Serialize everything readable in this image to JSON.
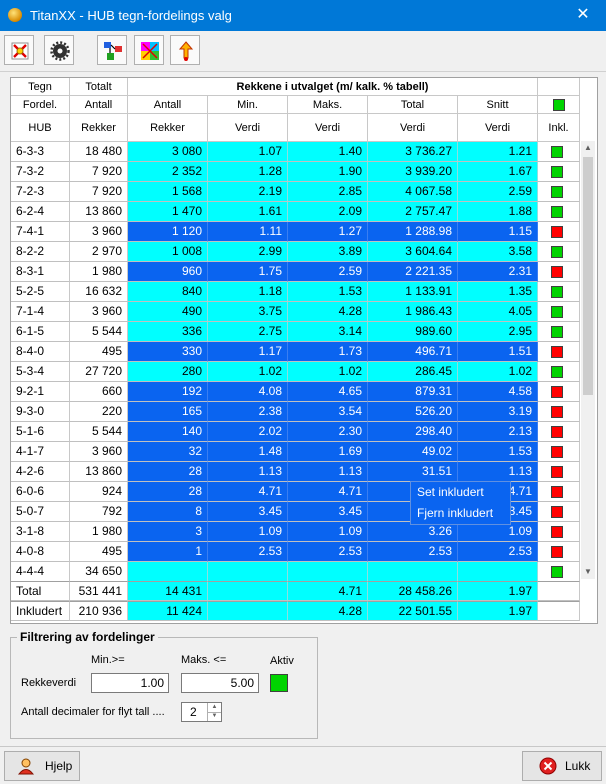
{
  "window": {
    "title": "TitanXX - HUB tegn-fordelings valg",
    "close_glyph": "✕"
  },
  "toolbar": {
    "buttons": [
      {
        "icon": "red-cross-star-icon"
      },
      {
        "icon": "gear-icon"
      },
      {
        "icon": "flowchart-icon"
      },
      {
        "icon": "color-grid-icon"
      },
      {
        "icon": "arrow-up-icon"
      }
    ]
  },
  "grid": {
    "header": {
      "col1": [
        "Tegn",
        "Fordel.",
        "HUB"
      ],
      "col2": [
        "Totalt",
        "Antall",
        "Rekker"
      ],
      "group_title": "Rekkene i utvalget (m/ kalk. % tabell)",
      "sub_cols": [
        [
          "Antall",
          "Rekker"
        ],
        [
          "Min.",
          "Verdi"
        ],
        [
          "Maks.",
          "Verdi"
        ],
        [
          "Total",
          "Verdi"
        ],
        [
          "Snitt",
          "Verdi"
        ]
      ],
      "incl": "Inkl."
    },
    "header_toggle_color": "#00d400",
    "rows": [
      {
        "hub": "6-3-3",
        "totalt": "18 480",
        "antall": "3 080",
        "min": "1.07",
        "maks": "1.40",
        "total": "3 736.27",
        "snitt": "1.21",
        "style": "cy",
        "incl": "g"
      },
      {
        "hub": "7-3-2",
        "totalt": "7 920",
        "antall": "2 352",
        "min": "1.28",
        "maks": "1.90",
        "total": "3 939.20",
        "snitt": "1.67",
        "style": "cy",
        "incl": "g"
      },
      {
        "hub": "7-2-3",
        "totalt": "7 920",
        "antall": "1 568",
        "min": "2.19",
        "maks": "2.85",
        "total": "4 067.58",
        "snitt": "2.59",
        "style": "cy",
        "incl": "g"
      },
      {
        "hub": "6-2-4",
        "totalt": "13 860",
        "antall": "1 470",
        "min": "1.61",
        "maks": "2.09",
        "total": "2 757.47",
        "snitt": "1.88",
        "style": "cy",
        "incl": "g"
      },
      {
        "hub": "7-4-1",
        "totalt": "3 960",
        "antall": "1 120",
        "min": "1.11",
        "maks": "1.27",
        "total": "1 288.98",
        "snitt": "1.15",
        "style": "bl",
        "incl": "r"
      },
      {
        "hub": "8-2-2",
        "totalt": "2 970",
        "antall": "1 008",
        "min": "2.99",
        "maks": "3.89",
        "total": "3 604.64",
        "snitt": "3.58",
        "style": "cy",
        "incl": "g"
      },
      {
        "hub": "8-3-1",
        "totalt": "1 980",
        "antall": "960",
        "min": "1.75",
        "maks": "2.59",
        "total": "2 221.35",
        "snitt": "2.31",
        "style": "bl",
        "incl": "r"
      },
      {
        "hub": "5-2-5",
        "totalt": "16 632",
        "antall": "840",
        "min": "1.18",
        "maks": "1.53",
        "total": "1 133.91",
        "snitt": "1.35",
        "style": "cy",
        "incl": "g"
      },
      {
        "hub": "7-1-4",
        "totalt": "3 960",
        "antall": "490",
        "min": "3.75",
        "maks": "4.28",
        "total": "1 986.43",
        "snitt": "4.05",
        "style": "cy",
        "incl": "g"
      },
      {
        "hub": "6-1-5",
        "totalt": "5 544",
        "antall": "336",
        "min": "2.75",
        "maks": "3.14",
        "total": "989.60",
        "snitt": "2.95",
        "style": "cy",
        "incl": "g"
      },
      {
        "hub": "8-4-0",
        "totalt": "495",
        "antall": "330",
        "min": "1.17",
        "maks": "1.73",
        "total": "496.71",
        "snitt": "1.51",
        "style": "bl",
        "incl": "r"
      },
      {
        "hub": "5-3-4",
        "totalt": "27 720",
        "antall": "280",
        "min": "1.02",
        "maks": "1.02",
        "total": "286.45",
        "snitt": "1.02",
        "style": "cy",
        "incl": "g"
      },
      {
        "hub": "9-2-1",
        "totalt": "660",
        "antall": "192",
        "min": "4.08",
        "maks": "4.65",
        "total": "879.31",
        "snitt": "4.58",
        "style": "bl",
        "incl": "r"
      },
      {
        "hub": "9-3-0",
        "totalt": "220",
        "antall": "165",
        "min": "2.38",
        "maks": "3.54",
        "total": "526.20",
        "snitt": "3.19",
        "style": "bl",
        "incl": "r"
      },
      {
        "hub": "5-1-6",
        "totalt": "5 544",
        "antall": "140",
        "min": "2.02",
        "maks": "2.30",
        "total": "298.40",
        "snitt": "2.13",
        "style": "bl",
        "incl": "r"
      },
      {
        "hub": "4-1-7",
        "totalt": "3 960",
        "antall": "32",
        "min": "1.48",
        "maks": "1.69",
        "total": "49.02",
        "snitt": "1.53",
        "style": "bl",
        "incl": "r"
      },
      {
        "hub": "4-2-6",
        "totalt": "13 860",
        "antall": "28",
        "min": "1.13",
        "maks": "1.13",
        "total": "31.51",
        "snitt": "1.13",
        "style": "bl",
        "incl": "r"
      },
      {
        "hub": "6-0-6",
        "totalt": "924",
        "antall": "28",
        "min": "4.71",
        "maks": "4.71",
        "total": "",
        "snitt": "4.71",
        "style": "bl",
        "incl": "r"
      },
      {
        "hub": "5-0-7",
        "totalt": "792",
        "antall": "8",
        "min": "3.45",
        "maks": "3.45",
        "total": "",
        "snitt": "3.45",
        "style": "bl",
        "incl": "r"
      },
      {
        "hub": "3-1-8",
        "totalt": "1 980",
        "antall": "3",
        "min": "1.09",
        "maks": "1.09",
        "total": "3.26",
        "snitt": "1.09",
        "style": "bl",
        "incl": "r"
      },
      {
        "hub": "4-0-8",
        "totalt": "495",
        "antall": "1",
        "min": "2.53",
        "maks": "2.53",
        "total": "2.53",
        "snitt": "2.53",
        "style": "bl",
        "incl": "r"
      },
      {
        "hub": "4-4-4",
        "totalt": "34 650",
        "antall": "",
        "min": "",
        "maks": "",
        "total": "",
        "snitt": "",
        "style": "cy",
        "incl": "g"
      }
    ],
    "totals": [
      {
        "label": "Total",
        "totalt": "531 441",
        "antall": "14 431",
        "min": "",
        "maks": "4.71",
        "total": "28 458.26",
        "snitt": "1.97"
      },
      {
        "label": "Inkludert",
        "totalt": "210 936",
        "antall": "11 424",
        "min": "",
        "maks": "4.28",
        "total": "22 501.55",
        "snitt": "1.97"
      }
    ],
    "colors": {
      "cyan": "#00ffff",
      "blue": "#0a64f0",
      "green": "#00d400",
      "red": "#ff0000"
    }
  },
  "context_menu": {
    "items": [
      "Set inkludert",
      "Fjern inkludert"
    ]
  },
  "filter": {
    "title": "Filtrering av fordelinger",
    "min_label": "Min.>=",
    "max_label": "Maks. <=",
    "aktiv_label": "Aktiv",
    "rekkeverdi_label": "Rekkeverdi",
    "min_value": "1.00",
    "max_value": "5.00",
    "decimals_label": "Antall decimaler for flyt tall ....",
    "decimals_value": "2"
  },
  "bottom": {
    "help_label": "Hjelp",
    "close_label": "Lukk"
  }
}
